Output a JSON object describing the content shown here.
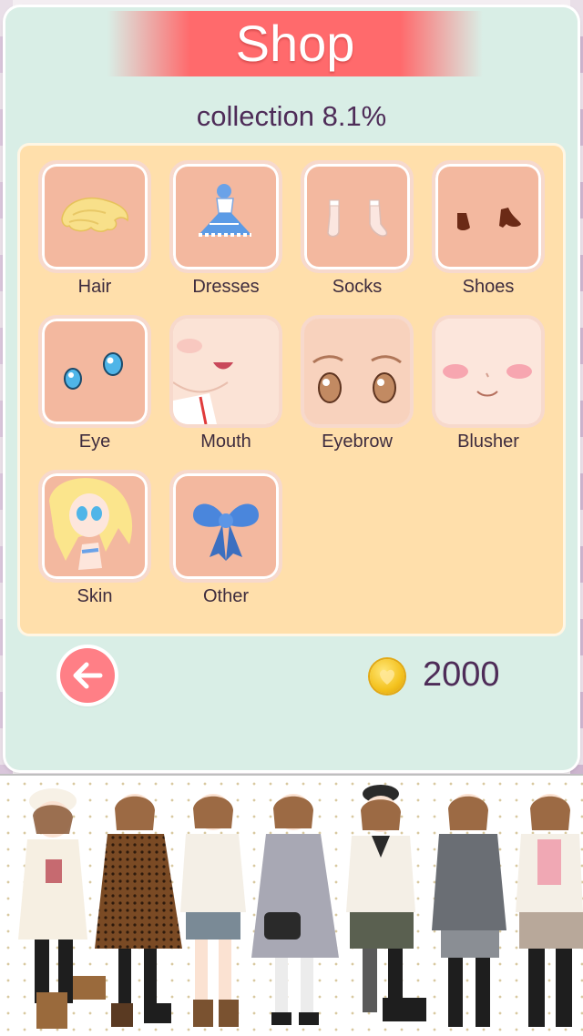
{
  "screen": {
    "title": "Shop",
    "collection_text": "collection 8.1%"
  },
  "categories": [
    {
      "label": "Hair",
      "icon": "hair-icon"
    },
    {
      "label": "Dresses",
      "icon": "dress-icon"
    },
    {
      "label": "Socks",
      "icon": "socks-icon"
    },
    {
      "label": "Shoes",
      "icon": "shoes-icon"
    },
    {
      "label": "Eye",
      "icon": "eye-icon"
    },
    {
      "label": "Mouth",
      "icon": "mouth-icon"
    },
    {
      "label": "Eyebrow",
      "icon": "eyebrow-icon"
    },
    {
      "label": "Blusher",
      "icon": "blusher-icon"
    },
    {
      "label": "Skin",
      "icon": "skin-icon"
    },
    {
      "label": "Other",
      "icon": "bow-icon"
    }
  ],
  "footer": {
    "back_icon": "back-arrow-icon",
    "coin_icon": "coin-heart-icon",
    "coins": "2000"
  },
  "colors": {
    "panel": "#d9eee6",
    "banner": "#ff6a6c",
    "grid": "#ffdfab",
    "tile": "#f3b89f",
    "text": "#4e2c58",
    "back_button": "#ff7f86"
  }
}
